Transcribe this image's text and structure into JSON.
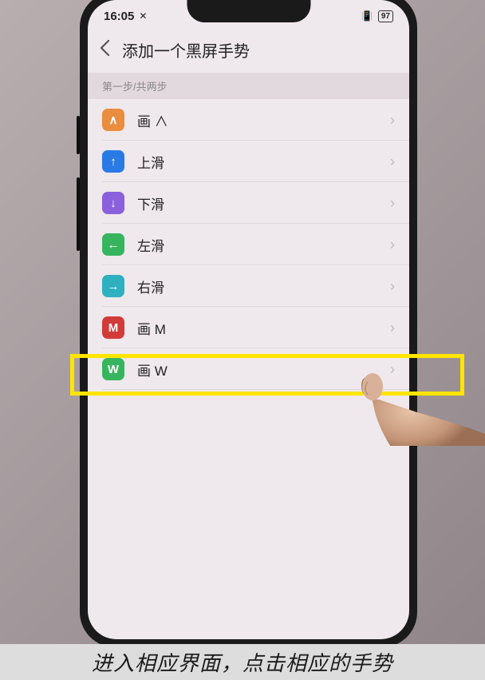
{
  "status": {
    "time": "16:05",
    "battery": "97"
  },
  "header": {
    "title": "添加一个黑屏手势"
  },
  "section_header": "第一步/共两步",
  "gestures": [
    {
      "label": "画 ∧",
      "icon_glyph": "∧",
      "icon_color": "ic-orange"
    },
    {
      "label": "上滑",
      "icon_glyph": "↑",
      "icon_color": "ic-blue"
    },
    {
      "label": "下滑",
      "icon_glyph": "↓",
      "icon_color": "ic-purple"
    },
    {
      "label": "左滑",
      "icon_glyph": "←",
      "icon_color": "ic-green"
    },
    {
      "label": "右滑",
      "icon_glyph": "→",
      "icon_color": "ic-teal"
    },
    {
      "label": "画 M",
      "icon_glyph": "M",
      "icon_color": "ic-red"
    },
    {
      "label": "画 W",
      "icon_glyph": "W",
      "icon_color": "ic-green2"
    }
  ],
  "caption": "进入相应界面，点击相应的手势"
}
